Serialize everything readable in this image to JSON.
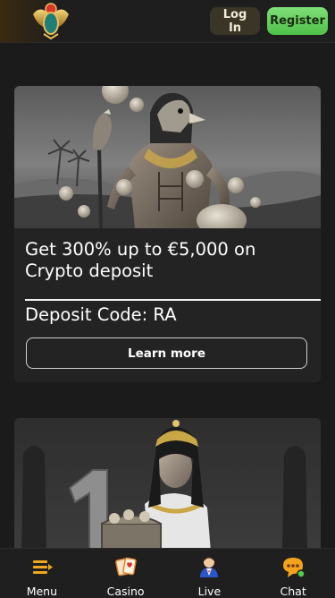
{
  "header": {
    "logo_icon": "scarab-logo-icon",
    "login_label": "Log In",
    "register_label": "Register",
    "colors": {
      "register": "#5ccf55",
      "login": "#3b3527",
      "background": "#1e1e1e"
    }
  },
  "promo": {
    "title": "Get 300% up to €5,000 on Crypto deposit",
    "deposit_code": "Deposit Code: RA",
    "cta_label": "Learn more"
  },
  "bottom_nav": {
    "items": [
      {
        "label": "Menu",
        "icon": "menu-icon"
      },
      {
        "label": "Casino",
        "icon": "cards-icon"
      },
      {
        "label": "Live",
        "icon": "dealer-icon"
      },
      {
        "label": "Chat",
        "icon": "chat-icon"
      }
    ]
  }
}
